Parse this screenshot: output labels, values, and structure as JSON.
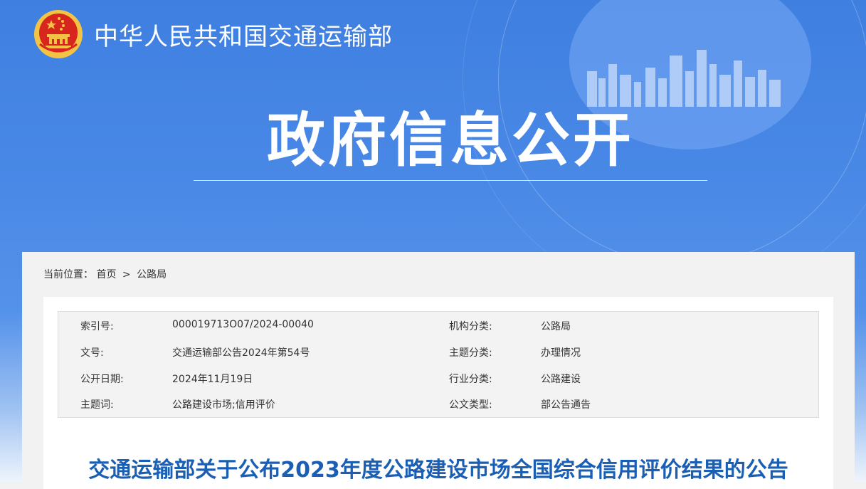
{
  "header": {
    "site_name": "中华人民共和国交通运输部",
    "banner_title": "政府信息公开"
  },
  "breadcrumb": {
    "label": "当前位置：",
    "items": [
      "首页",
      "公路局"
    ],
    "separator": ">"
  },
  "meta": {
    "rows": [
      {
        "k1": "索引号:",
        "v1": "000019713O07/2024-00040",
        "k2": "机构分类:",
        "v2": "公路局"
      },
      {
        "k1": "文号:",
        "v1": "交通运输部公告2024年第54号",
        "k2": "主题分类:",
        "v2": "办理情况"
      },
      {
        "k1": "公开日期:",
        "v1": "2024年11月19日",
        "k2": "行业分类:",
        "v2": "公路建设"
      },
      {
        "k1": "主题词:",
        "v1": "公路建设市场;信用评价",
        "k2": "公文类型:",
        "v2": "部公告通告"
      }
    ]
  },
  "document": {
    "title": "交通运输部关于公布2023年度公路建设市场全国综合信用评价结果的公告"
  },
  "colors": {
    "banner_blue": "#3f7fe0",
    "title_blue": "#1a5fb4",
    "emblem_red": "#d7261e",
    "emblem_gold": "#f3c443"
  }
}
